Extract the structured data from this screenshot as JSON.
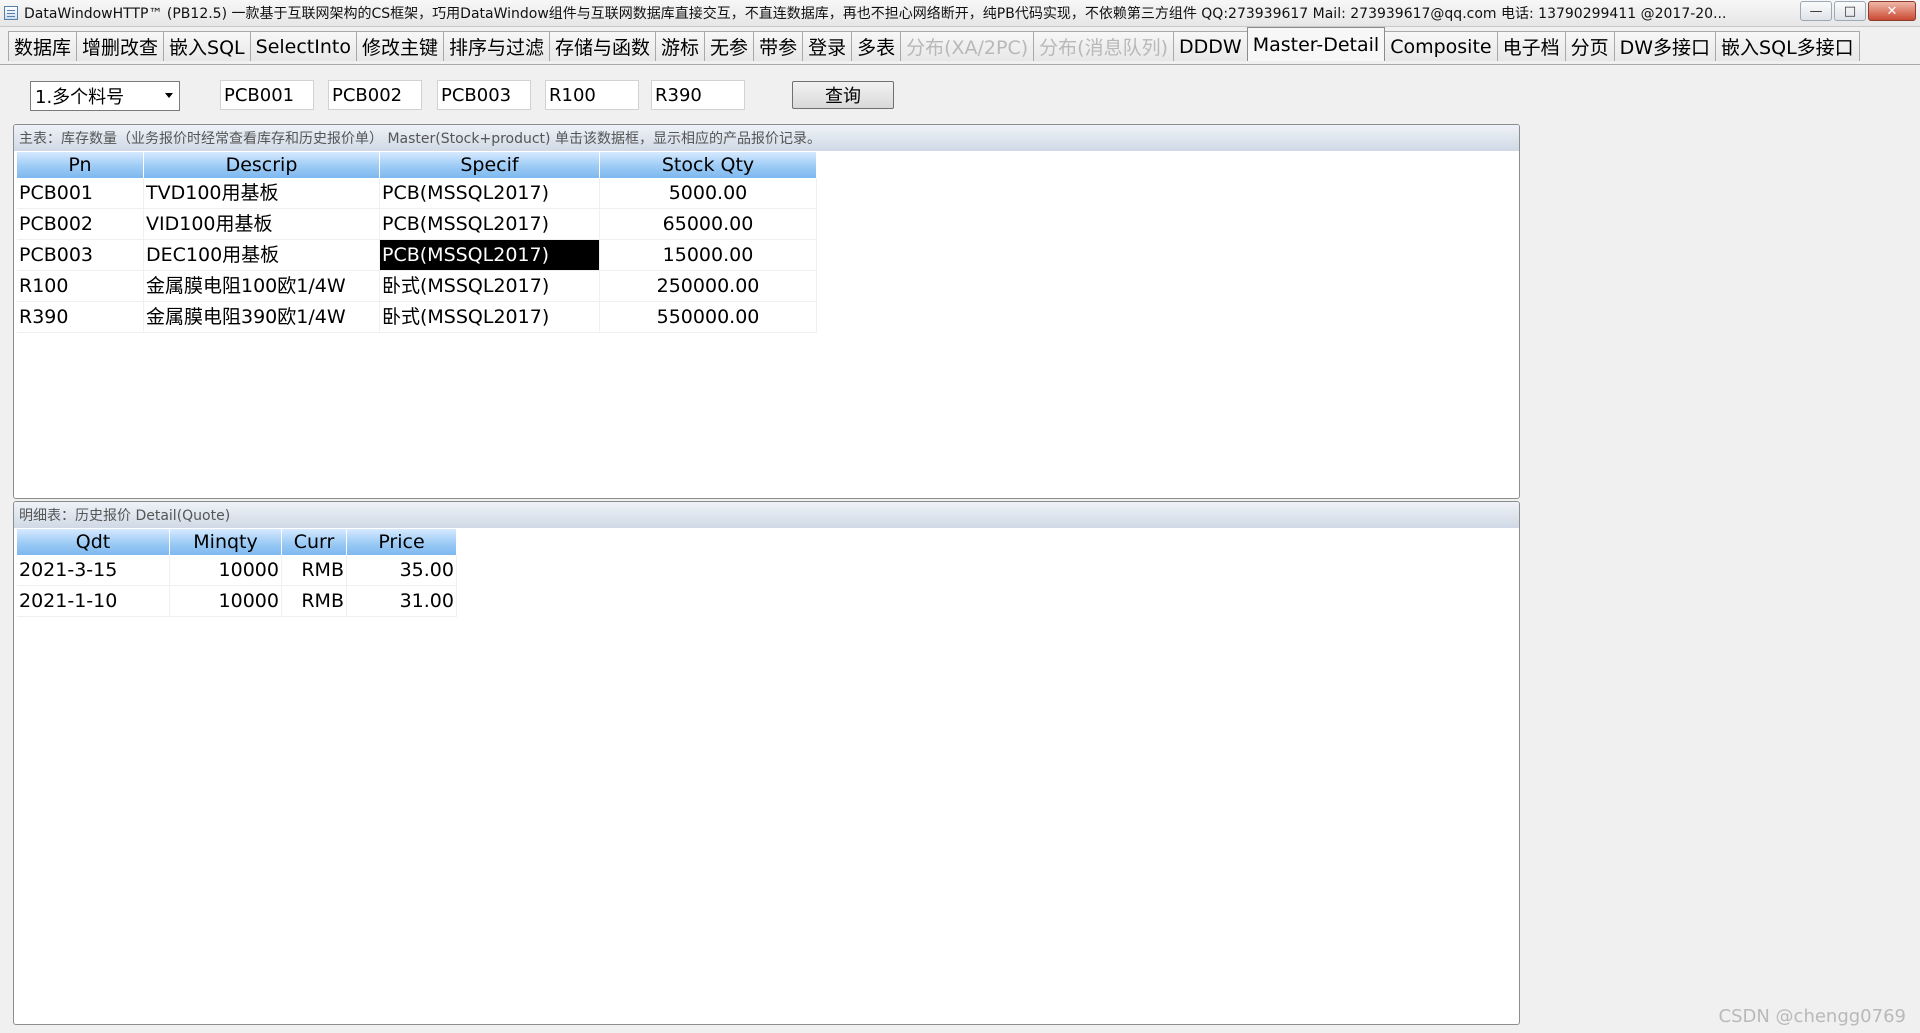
{
  "window": {
    "title": "DataWindowHTTP™ (PB12.5) 一款基于互联网架构的CS框架，巧用DataWindow组件与互联网数据库直接交互，不直连数据库，再也不担心网络断开，纯PB代码实现，不依赖第三方组件 QQ:273939617 Mail: 273939617@qq.com 电话: 13790299411 @2017-20...",
    "minimize_label": "—",
    "maximize_label": "□",
    "close_label": "✕"
  },
  "tabs": [
    {
      "label": "数据库"
    },
    {
      "label": "增删改查"
    },
    {
      "label": "嵌入SQL"
    },
    {
      "label": "SelectInto"
    },
    {
      "label": "修改主键"
    },
    {
      "label": "排序与过滤"
    },
    {
      "label": "存储与函数"
    },
    {
      "label": "游标"
    },
    {
      "label": "无参"
    },
    {
      "label": "带参"
    },
    {
      "label": "登录"
    },
    {
      "label": "多表"
    },
    {
      "label": "分布(XA/2PC)",
      "disabled": true
    },
    {
      "label": "分布(消息队列)",
      "disabled": true
    },
    {
      "label": "DDDW"
    },
    {
      "label": "Master-Detail",
      "active": true
    },
    {
      "label": "Composite"
    },
    {
      "label": "电子档"
    },
    {
      "label": "分页"
    },
    {
      "label": "DW多接口"
    },
    {
      "label": "嵌入SQL多接口"
    }
  ],
  "query": {
    "mode_selected": "1.多个料号",
    "inputs": [
      "PCB001",
      "PCB002",
      "PCB003",
      "R100",
      "R390"
    ],
    "button_label": "查询"
  },
  "master": {
    "caption": "主表：库存数量（业务报价时经常查看库存和历史报价单）   Master(Stock+product)    单击该数据框，显示相应的产品报价记录。",
    "columns": [
      "Pn",
      "Descrip",
      "Specif",
      "Stock Qty"
    ],
    "rows": [
      [
        "PCB001",
        "TVD100用基板",
        "PCB(MSSQL2017)",
        "5000.00"
      ],
      [
        "PCB002",
        "VID100用基板",
        "PCB(MSSQL2017)",
        "65000.00"
      ],
      [
        "PCB003",
        "DEC100用基板",
        "PCB(MSSQL2017)",
        "15000.00"
      ],
      [
        "R100",
        "金属膜电阻100欧1/4W",
        "卧式(MSSQL2017)",
        "250000.00"
      ],
      [
        "R390",
        "金属膜电阻390欧1/4W",
        "卧式(MSSQL2017)",
        "550000.00"
      ]
    ],
    "selected_row": 2,
    "selected_col": 2
  },
  "detail": {
    "caption": "明细表：历史报价   Detail(Quote)",
    "columns": [
      "Qdt",
      "Minqty",
      "Curr",
      "Price"
    ],
    "rows": [
      [
        "2021-3-15",
        "10000",
        "RMB",
        "35.00"
      ],
      [
        "2021-1-10",
        "10000",
        "RMB",
        "31.00"
      ]
    ]
  },
  "watermark": "CSDN @chengg0769"
}
